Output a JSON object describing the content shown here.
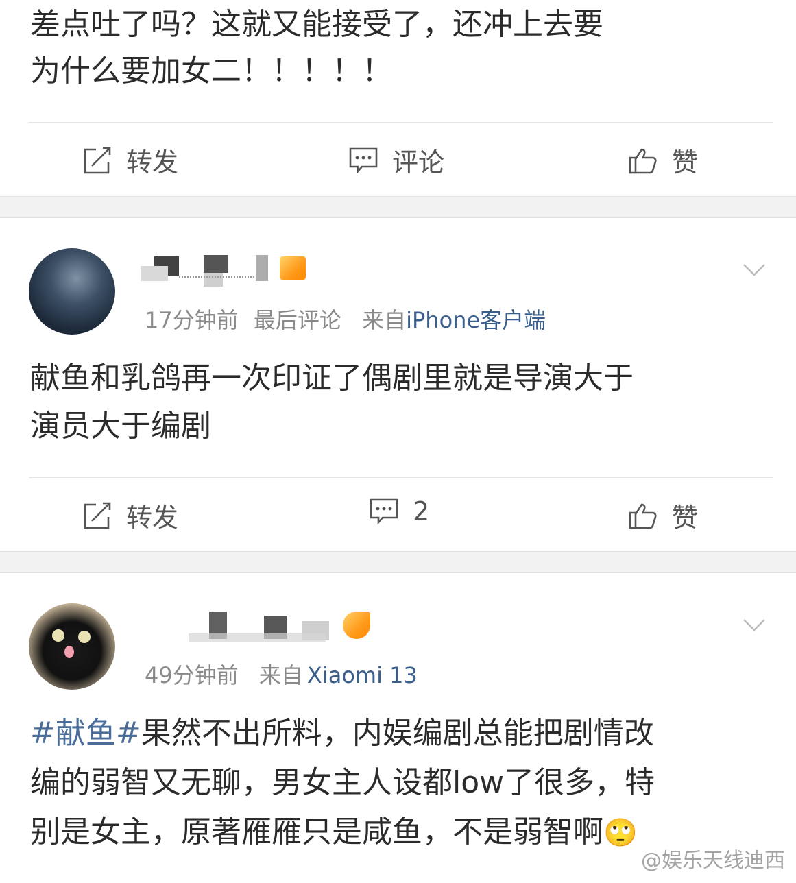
{
  "post_top": {
    "text_line1": "差点吐了吗？这就又能接受了，还冲上去要",
    "text_line2": "为什么要加女二！！！！！",
    "actions": {
      "repost": "转发",
      "comment": "评论",
      "like": "赞"
    }
  },
  "comment_1": {
    "time": "17分钟前",
    "last_comment": "最后评论",
    "from_label": "来自",
    "source": "iPhone客户端",
    "text_line1": "献鱼和乳鸽再一次印证了偶剧里就是导演大于",
    "text_line2": "演员大于编剧",
    "actions": {
      "repost": "转发",
      "comment_count": "2",
      "like": "赞"
    }
  },
  "comment_2": {
    "time": "49分钟前",
    "from_label": "来自",
    "source": "Xiaomi 13",
    "hashtag": "#献鱼#",
    "text_line1_rest": "果然不出所料，内娱编剧总能把剧情改",
    "text_line2": "编的弱智又无聊，男女主人设都low了很多，特",
    "text_line3": "别是女主，原著雁雁只是咸鱼，不是弱智啊",
    "emoji": "🙄"
  },
  "watermark": "@娱乐天线迪西",
  "colors": {
    "link": "#3a5f8c",
    "hashtag": "#4a6d9a",
    "muted": "#8a8a8a",
    "separator": "#f2f2f2",
    "badge": "#ff9a1a"
  }
}
